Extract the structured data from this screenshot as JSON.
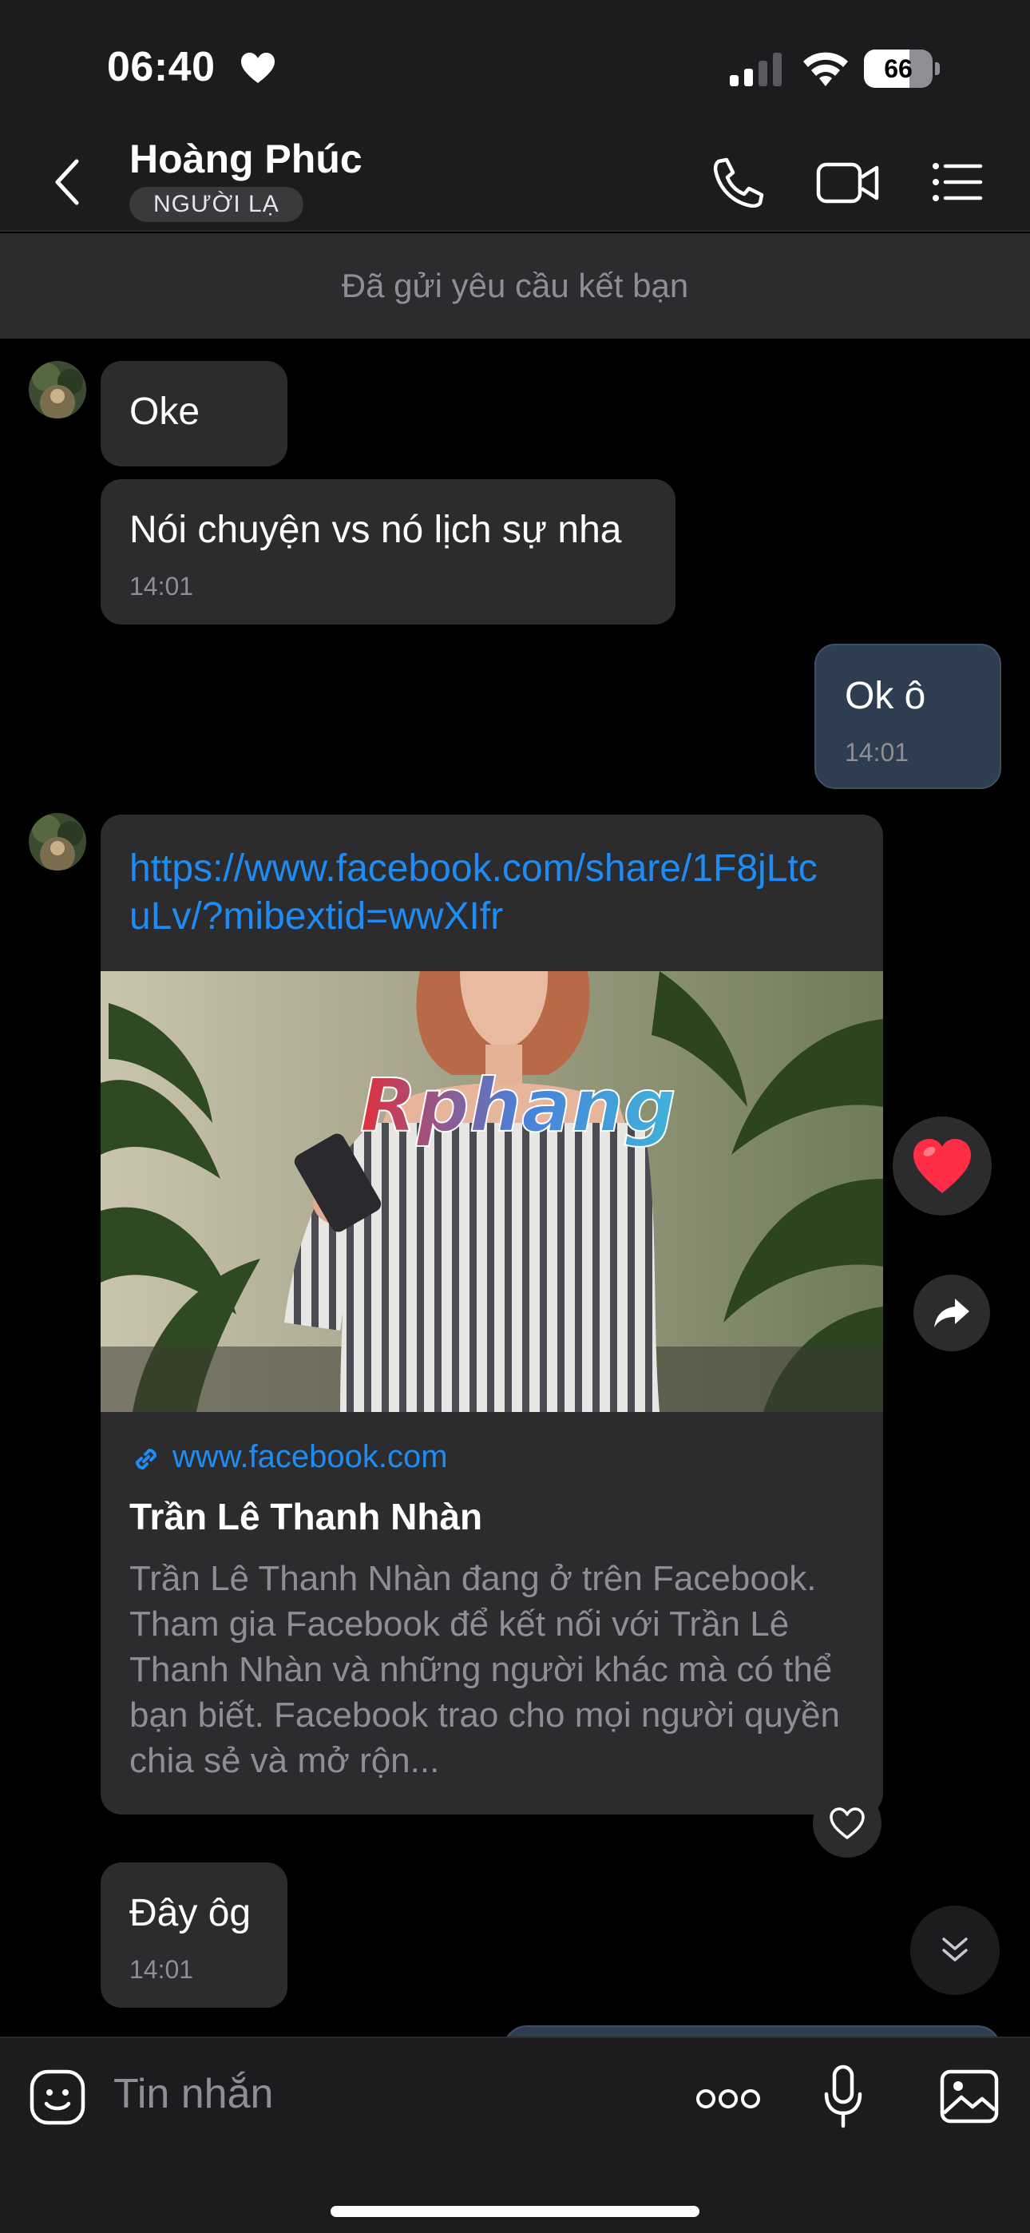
{
  "status_bar": {
    "time": "06:40",
    "battery": "66",
    "battery_level": 0.66
  },
  "header": {
    "contact_name": "Hoàng Phúc",
    "stranger_badge": "NGƯỜI LẠ",
    "icons": [
      "back-icon",
      "phone-icon",
      "video-call-icon",
      "menu-icon"
    ]
  },
  "friend_request": {
    "text": "Đã gửi yêu cầu kết bạn"
  },
  "messages": [
    {
      "direction": "in",
      "text": "Oke",
      "time": ""
    },
    {
      "direction": "in",
      "text": "Nói chuyện vs nó lịch sự nha",
      "time": "14:01"
    },
    {
      "direction": "out",
      "text": "Ok ô",
      "time": "14:01"
    },
    {
      "direction": "in",
      "type": "link",
      "url": "https://www.facebook.com/share/1F8jLtcuLv/?mibextid=wwXIfr",
      "preview": {
        "watermark": "Rphang",
        "domain": "www.facebook.com",
        "title": "Trần Lê Thanh Nhàn",
        "description": "Trần Lê Thanh Nhàn đang ở trên Facebook. Tham gia Facebook để kết nối với Trần Lê Thanh Nhàn và những người khác mà có thể bạn biết. Facebook trao cho mọi người quyền chia sẻ và mở rộn..."
      }
    },
    {
      "direction": "in",
      "text": "Đây ôg",
      "time": "14:01"
    }
  ],
  "reactions": {
    "heart": "heart-reaction-icon",
    "forward": "share-forward-icon",
    "like": "heart-outline-icon"
  },
  "input": {
    "placeholder": "Tin nhắn"
  },
  "colors": {
    "link": "#1e8cf2",
    "incoming_bubble": "#2c2c2e",
    "outgoing_bubble": "#2f3d50",
    "reaction_red": "#ff2d46"
  }
}
